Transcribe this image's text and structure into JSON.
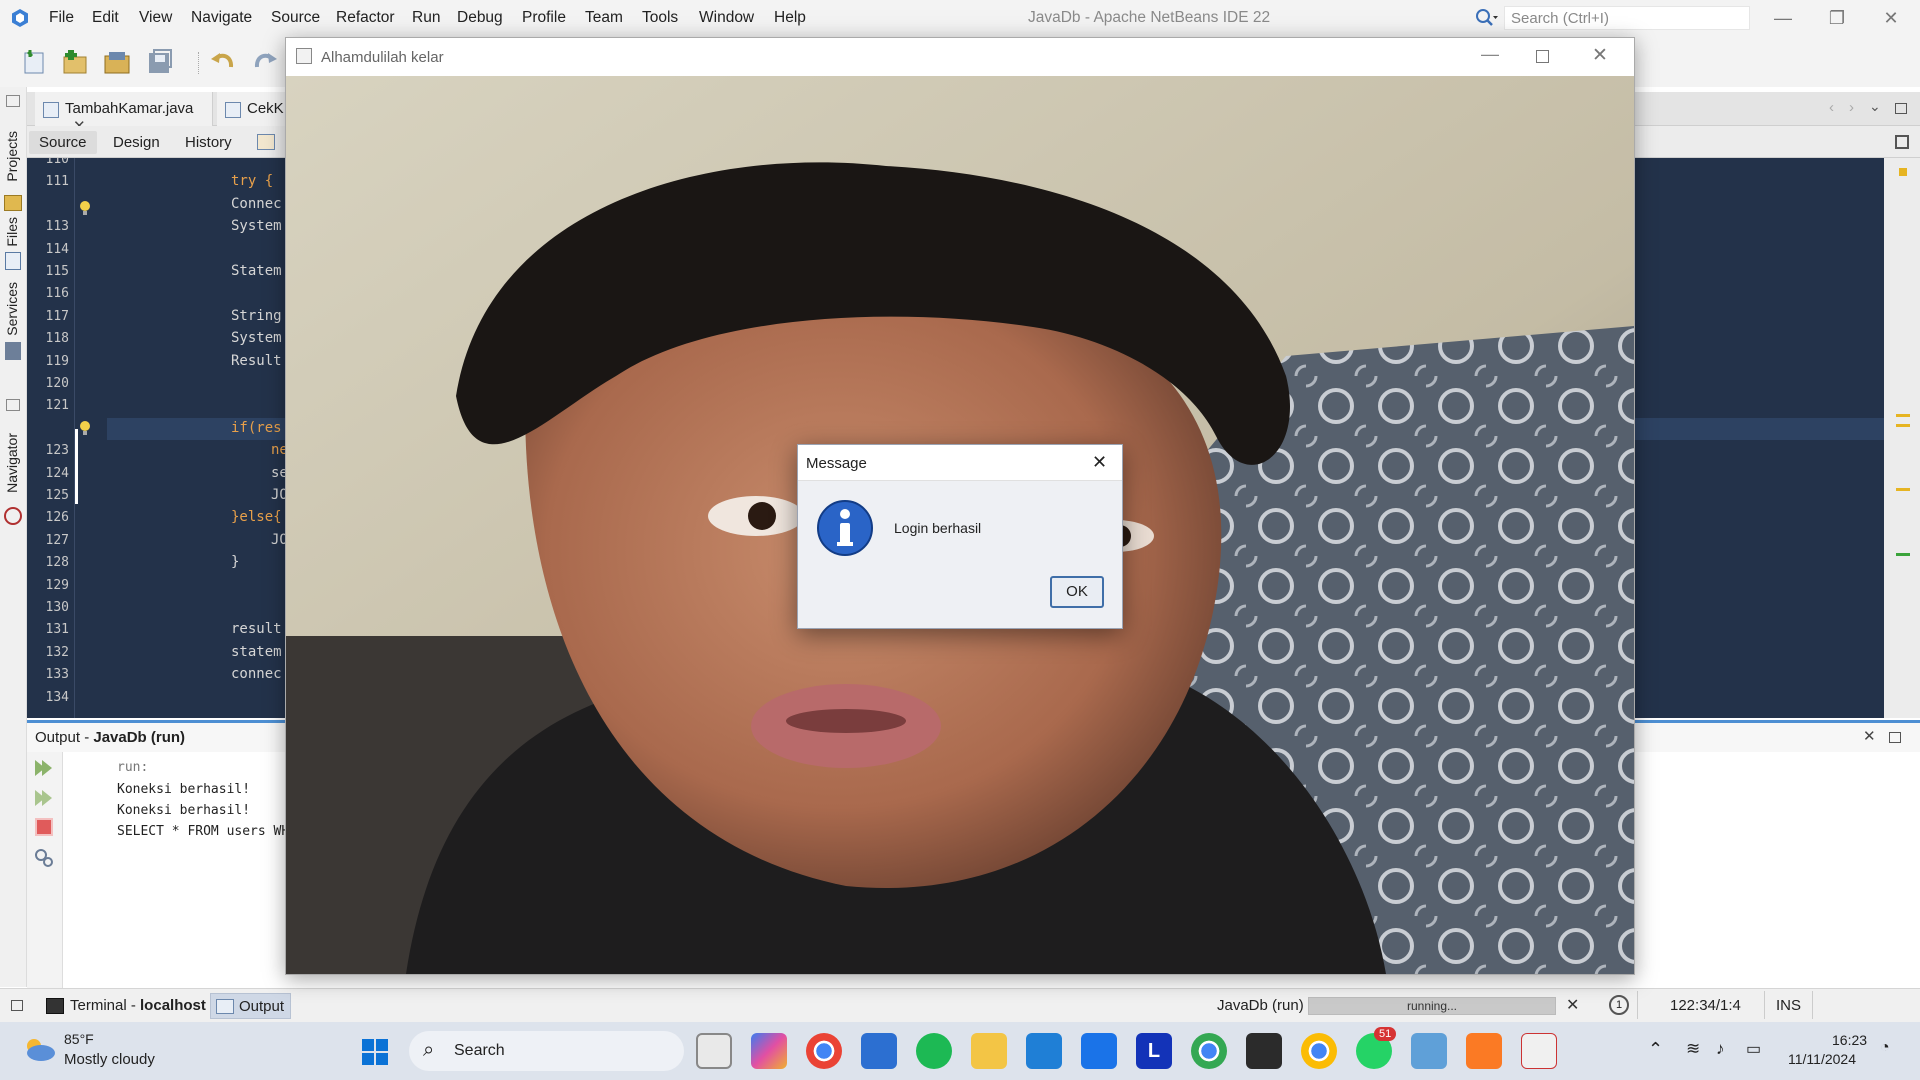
{
  "menu": [
    "File",
    "Edit",
    "View",
    "Navigate",
    "Source",
    "Refactor",
    "Run",
    "Debug",
    "Profile",
    "Team",
    "Tools",
    "Window",
    "Help"
  ],
  "window_title": "JavaDb - Apache NetBeans IDE 22",
  "search_placeholder": "Search (Ctrl+I)",
  "side_labels": [
    "Projects",
    "Files",
    "Services",
    "Navigator"
  ],
  "editor_tabs": [
    {
      "label": "TambahKamar.java"
    },
    {
      "label": "CekK"
    }
  ],
  "view_tabs": [
    "Source",
    "Design",
    "History"
  ],
  "line_numbers": [
    "110",
    "111",
    "",
    "113",
    "114",
    "115",
    "116",
    "117",
    "118",
    "119",
    "120",
    "121",
    "",
    "123",
    "124",
    "125",
    "126",
    "127",
    "128",
    "129",
    "130",
    "131",
    "132",
    "133",
    "134"
  ],
  "code_lines": [
    {
      "line": "111",
      "text": "try {",
      "kw": true
    },
    {
      "line": "112",
      "text": "Connec",
      "kw": false
    },
    {
      "line": "113",
      "text": "System",
      "kw": false
    },
    {
      "line": "115",
      "text": "Statem",
      "kw": false
    },
    {
      "line": "117",
      "text": "String",
      "kw": false
    },
    {
      "line": "118",
      "text": "System",
      "kw": false
    },
    {
      "line": "119",
      "text": "Result",
      "kw": false
    },
    {
      "line": "122",
      "text": "if(res",
      "kw": true
    },
    {
      "line": "123",
      "text": "ne",
      "kw": true
    },
    {
      "line": "124",
      "text": "se",
      "kw": false
    },
    {
      "line": "125",
      "text": "JO",
      "kw": false
    },
    {
      "line": "126",
      "text": "}else{",
      "kw": true
    },
    {
      "line": "127",
      "text": "JO",
      "kw": false
    },
    {
      "line": "128",
      "text": "}",
      "kw": false
    },
    {
      "line": "131",
      "text": "result",
      "kw": false
    },
    {
      "line": "132",
      "text": "statem",
      "kw": false
    },
    {
      "line": "133",
      "text": "connec",
      "kw": false
    }
  ],
  "output": {
    "title_prefix": "Output - ",
    "title_run": "JavaDb (run)",
    "lines": [
      "run:",
      "Koneksi berhasil!",
      "Koneksi berhasil!",
      "SELECT * FROM users WH"
    ]
  },
  "bottom_tabs": {
    "terminal_label": "Terminal - ",
    "terminal_host": "localhost",
    "output_label": "Output"
  },
  "status": {
    "process": "JavaDb (run)",
    "progress_text": "running...",
    "position": "122:34/1:4",
    "mode": "INS",
    "notif_count": "1"
  },
  "app_window": {
    "title": "Alhamdulilah kelar"
  },
  "dialog": {
    "title": "Message",
    "message": "Login berhasil",
    "ok_label": "OK"
  },
  "taskbar": {
    "weather_temp": "85°F",
    "weather_desc": "Mostly cloudy",
    "search_label": "Search",
    "time": "16:23",
    "date": "11/11/2024",
    "whatsapp_badge": "51",
    "apps": [
      "start-icon",
      "search-icon",
      "task-view-icon",
      "copilot-icon",
      "chrome-icon",
      "altair-icon",
      "spotify-icon",
      "file-explorer-icon",
      "vscode-icon",
      "edge-bar-icon",
      "l-app-icon",
      "chrome-profile-icon",
      "terminal-icon",
      "chrome-profile2-icon",
      "whatsapp-icon",
      "netbeans-icon",
      "xampp-icon",
      "java-icon"
    ]
  },
  "colors": {
    "editor_bg": "#23324a",
    "keyword": "#e8a04a",
    "accent": "#4d8fd3",
    "info_icon": "#2a64c7"
  }
}
